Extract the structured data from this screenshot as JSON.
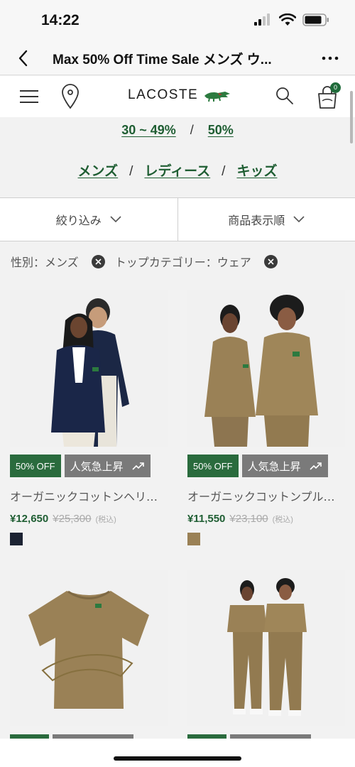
{
  "status": {
    "time": "14:22"
  },
  "header": {
    "title": "Max 50% Off Time Sale メンズ ウ..."
  },
  "brand": {
    "name": "LACOSTE"
  },
  "cart": {
    "count": "0"
  },
  "discount_links": {
    "low": "30 ~ 49%",
    "sep": "/",
    "high": "50%"
  },
  "category_links": {
    "men": "メンズ",
    "women": "レディース",
    "kids": "キッズ",
    "sep": "/"
  },
  "controls": {
    "filter_label": "絞り込み",
    "sort_label": "商品表示順"
  },
  "applied_filters": [
    {
      "label": "性別：メンズ"
    },
    {
      "label": "トップカテゴリー：ウェア"
    }
  ],
  "products": [
    {
      "discount_badge": "50% OFF",
      "trend_badge": "人気急上昇",
      "name": "オーガニックコットンヘリテ…",
      "sale_price": "¥12,650",
      "original_price": "¥25,300",
      "tax_note": "(税込)",
      "swatch_color": "#1c2333"
    },
    {
      "discount_badge": "50% OFF",
      "trend_badge": "人気急上昇",
      "name": "オーガニックコットンプルオ…",
      "sale_price": "¥11,550",
      "original_price": "¥23,100",
      "tax_note": "(税込)",
      "swatch_color": "#9a8156"
    }
  ],
  "colors": {
    "accent_green": "#1f5e33",
    "badge_green": "#2a6b3d",
    "badge_grey": "#7a7a7a"
  }
}
